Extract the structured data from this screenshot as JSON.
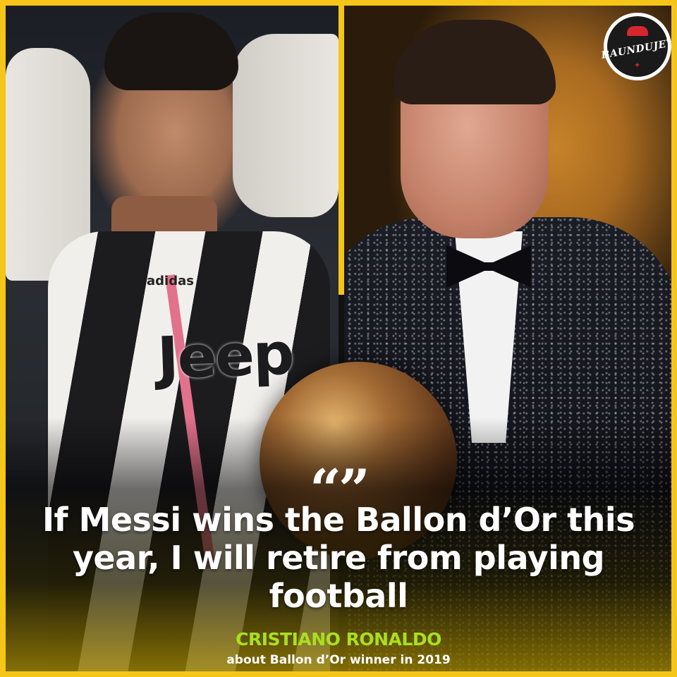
{
  "left_photo": {
    "sponsor_text": "Jeep",
    "brand_text": "adidas"
  },
  "logo": {
    "text": "BAUNDUJEY"
  },
  "quote": {
    "mark": "“”",
    "text": "If Messi wins the Ballon d’Or this year, I will retire from playing football"
  },
  "attribution": {
    "name": "CRISTIANO RONALDO",
    "context": "about Ballon d’Or winner in 2019"
  },
  "colors": {
    "frame": "#f5c518",
    "author": "#a8e01f",
    "quote": "#ffffff"
  }
}
